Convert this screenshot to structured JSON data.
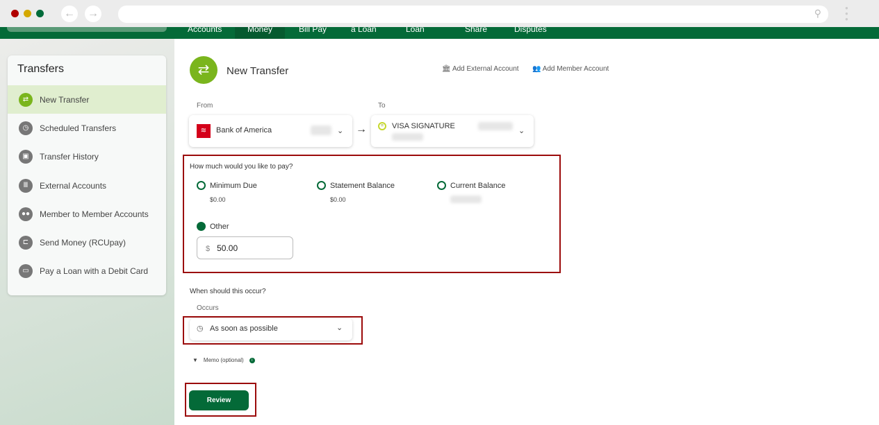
{
  "browser": {
    "back_icon": "arrow-left",
    "forward_icon": "arrow-right",
    "search_icon": "magnifier"
  },
  "nav": {
    "items": [
      "Accounts",
      "Money",
      "Bill Pay",
      "a Loan",
      "Loan",
      "Share",
      "Disputes"
    ],
    "active": "Money"
  },
  "sidebar": {
    "title": "Transfers",
    "items": [
      {
        "label": "New Transfer",
        "icon": "transfer-arrows",
        "active": true
      },
      {
        "label": "Scheduled Transfers",
        "icon": "clock"
      },
      {
        "label": "Transfer History",
        "icon": "calendar-check"
      },
      {
        "label": "External Accounts",
        "icon": "bank"
      },
      {
        "label": "Member to Member Accounts",
        "icon": "people"
      },
      {
        "label": "Send Money (RCUpay)",
        "icon": "send"
      },
      {
        "label": "Pay a Loan with a Debit Card",
        "icon": "card"
      }
    ]
  },
  "header": {
    "title": "New Transfer",
    "add_external": "Add External Account",
    "add_member": "Add Member Account"
  },
  "from": {
    "label": "From",
    "account": "Bank of America"
  },
  "to": {
    "label": "To",
    "account": "VISA SIGNATURE"
  },
  "pay": {
    "question": "How much would you like to pay?",
    "options": [
      {
        "label": "Minimum Due",
        "amount": "$0.00"
      },
      {
        "label": "Statement Balance",
        "amount": "$0.00"
      },
      {
        "label": "Current Balance"
      },
      {
        "label": "Other",
        "selected": true
      }
    ],
    "currency": "$",
    "value": "50.00"
  },
  "occur": {
    "question": "When should this occur?",
    "label": "Occurs",
    "value": "As soon as possible"
  },
  "memo": {
    "label": "Memo (optional)"
  },
  "review": "Review",
  "colors": {
    "brand": "#046a38",
    "accent": "#7ab51d",
    "highlight": "#9b0a0a"
  }
}
